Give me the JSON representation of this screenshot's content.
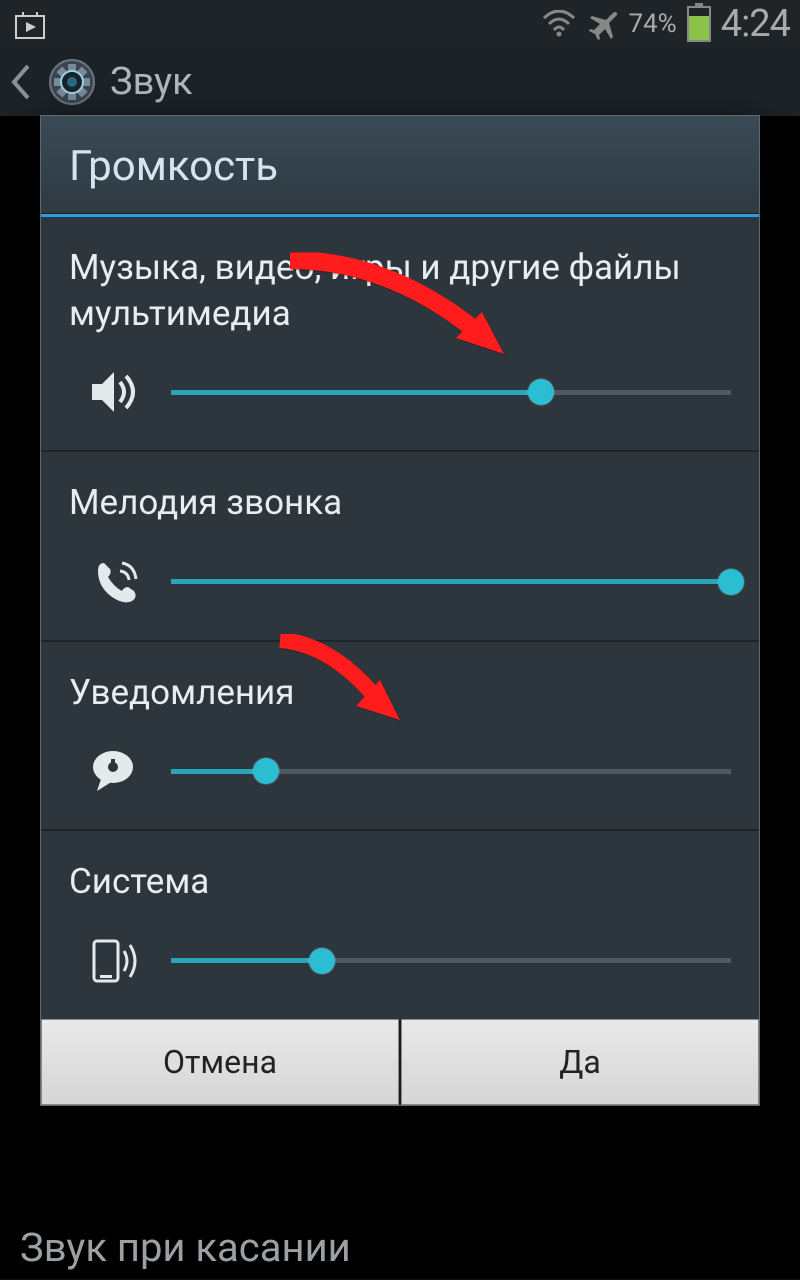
{
  "status": {
    "battery_pct": "74%",
    "time": "4:24"
  },
  "app_bar": {
    "title": "Звук"
  },
  "dialog": {
    "title": "Громкость",
    "sections": {
      "media": {
        "label": "Музыка, видео, игры и другие файлы мультимедиа",
        "value": 66
      },
      "ring": {
        "label": "Мелодия звонка",
        "value": 100
      },
      "notif": {
        "label": "Уведомления",
        "value": 17
      },
      "system": {
        "label": "Система",
        "value": 27
      }
    },
    "buttons": {
      "cancel": "Отмена",
      "ok": "Да"
    }
  },
  "backdrop_item": "Звук при касании",
  "colors": {
    "accent": "#2bbdd2",
    "arrow": "#ff1a1a"
  }
}
